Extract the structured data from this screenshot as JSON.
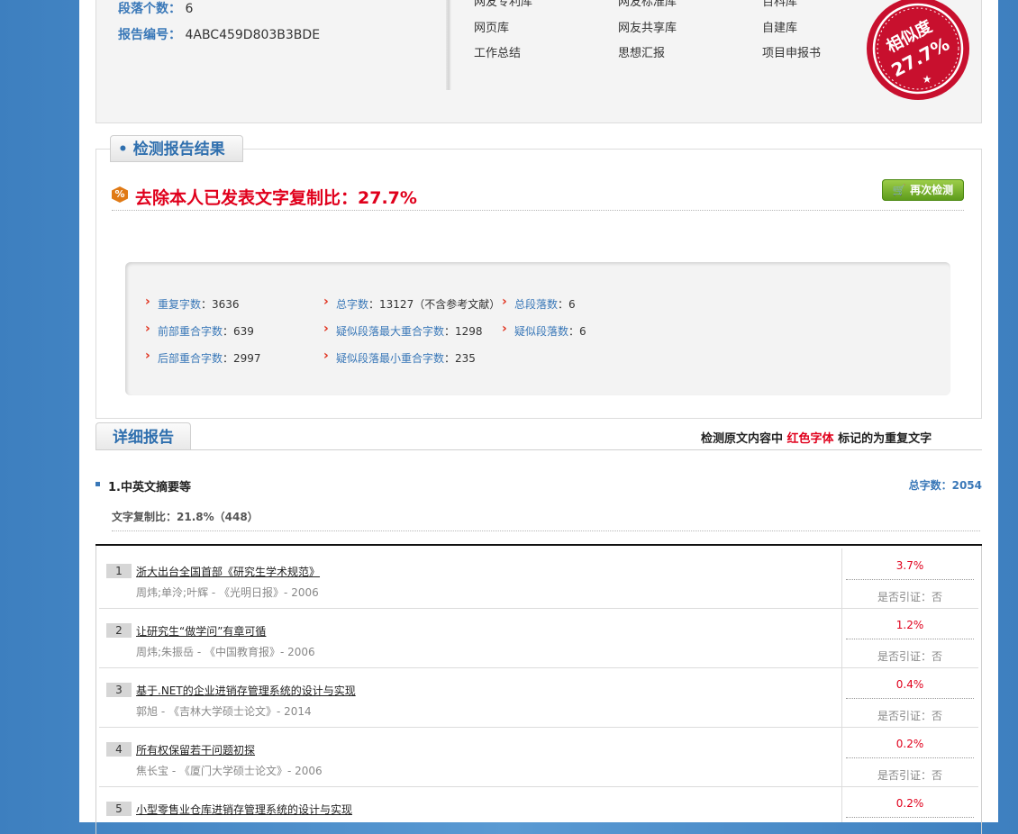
{
  "top_info": {
    "paragraph_count_label": "段落个数：",
    "paragraph_count": "6",
    "report_id_label": "报告编号：",
    "report_id": "4ABC459D803B3BDE"
  },
  "databases": {
    "row0": [
      "网友专利库",
      "网友标准库",
      "百科库"
    ],
    "row1": [
      "网页库",
      "网友共享库",
      "自建库"
    ],
    "row2": [
      "工作总结",
      "思想汇报",
      "项目申报书"
    ]
  },
  "stamp": {
    "label": "相似度",
    "value": "27.7%",
    "color": "#c8102e"
  },
  "result": {
    "tab_label": "检测报告结果",
    "badge": "%",
    "headline": "去除本人已发表文字复制比：27.7%",
    "recheck_label": "再次检测"
  },
  "stats": [
    {
      "label": "重复字数",
      "value": "3636"
    },
    {
      "label": "总字数",
      "value": "13127（不含参考文献）"
    },
    {
      "label": "总段落数",
      "value": "6"
    },
    {
      "label": "前部重合字数",
      "value": "639"
    },
    {
      "label": "疑似段落最大重合字数",
      "value": "1298"
    },
    {
      "label": "疑似段落数",
      "value": "6"
    },
    {
      "label": "后部重合字数",
      "value": "2997"
    },
    {
      "label": "疑似段落最小重合字数",
      "value": "235"
    }
  ],
  "detail": {
    "tab_label": "详细报告",
    "legend_prefix": "检测原文内容中",
    "legend_red": "红色字体",
    "legend_suffix": "标记的为重复文字",
    "section_title": "1.中英文摘要等",
    "total_words": "总字数：2054",
    "copy_ratio": "文字复制比：21.8%（448）"
  },
  "sources": [
    {
      "num": "1",
      "title": "浙大出台全国首部《研究生学术规范》",
      "meta": "周炜;单泠;叶辉 - 《光明日报》- 2006",
      "pct": "3.7%",
      "cite": "是否引证：否"
    },
    {
      "num": "2",
      "title": "让研究生“做学问”有章可循",
      "meta": "周炜;朱振岳 - 《中国教育报》- 2006",
      "pct": "1.2%",
      "cite": "是否引证：否"
    },
    {
      "num": "3",
      "title": "基于.NET的企业进销存管理系统的设计与实现",
      "meta": "郭旭 - 《吉林大学硕士论文》- 2014",
      "pct": "0.4%",
      "cite": "是否引证：否"
    },
    {
      "num": "4",
      "title": "所有权保留若干问题初探",
      "meta": "焦长宝 - 《厦门大学硕士论文》- 2006",
      "pct": "0.2%",
      "cite": "是否引证：否"
    },
    {
      "num": "5",
      "title": "小型零售业仓库进销存管理系统的设计与实现",
      "meta": "",
      "pct": "0.2%",
      "cite": ""
    }
  ]
}
